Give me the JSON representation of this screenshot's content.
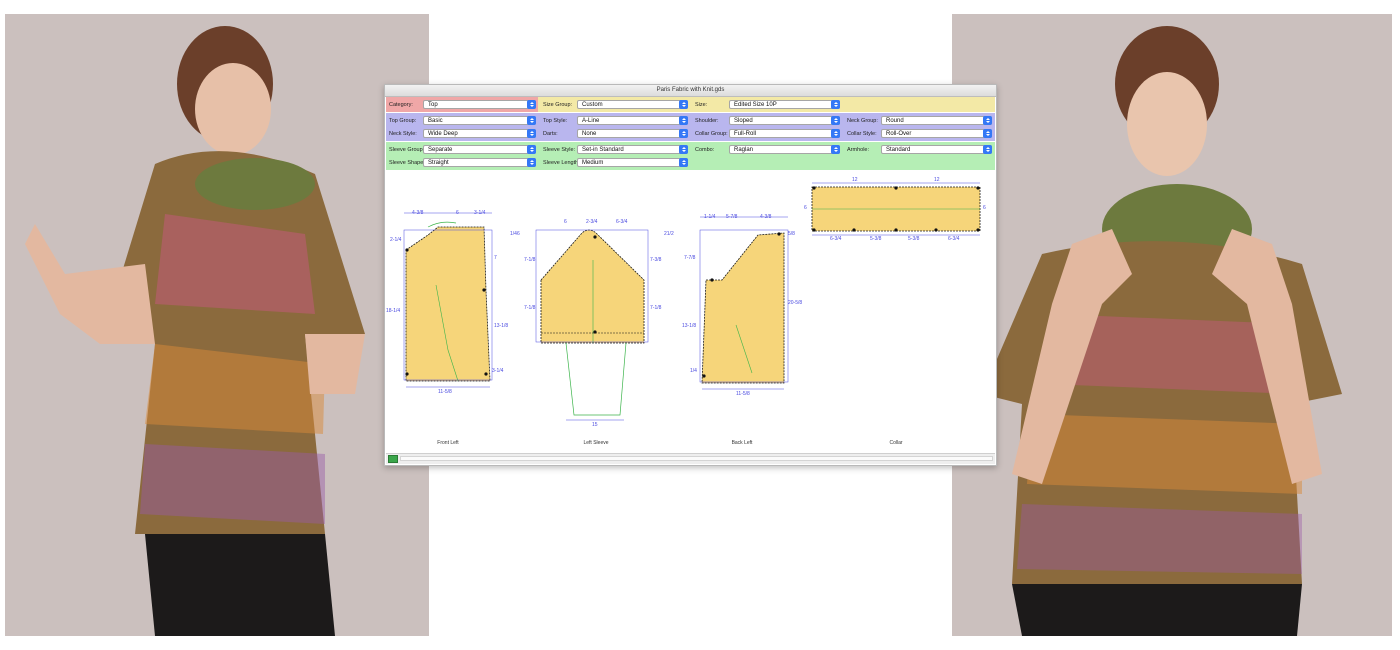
{
  "window": {
    "title": "Paris Fabric with Knit.gds"
  },
  "fields": {
    "category": {
      "label": "Category:",
      "value": "Top"
    },
    "size_group": {
      "label": "Size Group:",
      "value": "Custom"
    },
    "size": {
      "label": "Size:",
      "value": "Edited Size 10P"
    },
    "top_group": {
      "label": "Top Group:",
      "value": "Basic"
    },
    "top_style": {
      "label": "Top Style:",
      "value": "A-Line"
    },
    "shoulder": {
      "label": "Shoulder:",
      "value": "Sloped"
    },
    "neck_group": {
      "label": "Neck Group:",
      "value": "Round"
    },
    "neck_style": {
      "label": "Neck Style:",
      "value": "Wide Deep"
    },
    "darts": {
      "label": "Darts:",
      "value": "None"
    },
    "collar_group": {
      "label": "Collar Group:",
      "value": "Full-Roll"
    },
    "collar_style": {
      "label": "Collar Style:",
      "value": "Roll-Over"
    },
    "sleeve_group": {
      "label": "Sleeve Group:",
      "value": "Separate"
    },
    "sleeve_style": {
      "label": "Sleeve Style:",
      "value": "Set-in Standard"
    },
    "combo": {
      "label": "Combo:",
      "value": "Raglan"
    },
    "armhole": {
      "label": "Armhole:",
      "value": "Standard"
    },
    "sleeve_shape": {
      "label": "Sleeve Shape:",
      "value": "Straight"
    },
    "sleeve_length": {
      "label": "Sleeve Length:",
      "value": "Medium"
    }
  },
  "pieces": {
    "front_left": "Front Left",
    "left_sleeve": "Left Sleeve",
    "back_left": "Back Left",
    "collar": "Collar"
  },
  "measurements": {
    "front": [
      "4-3/8",
      "6",
      "3-1/4",
      "2-1/4",
      "7",
      "18-1/4",
      "13-1/8",
      "3-1/4",
      "11-5/8"
    ],
    "sleeve": [
      "6",
      "2-3/4",
      "6-3/4",
      "1/46",
      "21/2",
      "7-1/8",
      "7-3/8",
      "7-1/8",
      "7-1/8",
      "15"
    ],
    "back": [
      "1-1/4",
      "5-7/8",
      "4-3/8",
      "5/8",
      "7-7/8",
      "20-5/8",
      "13-1/8",
      "1/4",
      "11-5/8"
    ],
    "collar": [
      "12",
      "12",
      "6",
      "6",
      "6-3/4",
      "5-3/8",
      "5-3/8",
      "6-3/4"
    ]
  },
  "colors": {
    "pattern_fill": "#f6d57a",
    "grid_line": "#4a4ae0",
    "guide_line": "#3cb44b",
    "band_category": "#f3e9a6",
    "band_top": "#b9b6ee",
    "band_sleeve": "#b5eeb5",
    "popup_arrow": "#3478f6"
  },
  "icons": {
    "status_button": "green-square-icon"
  }
}
